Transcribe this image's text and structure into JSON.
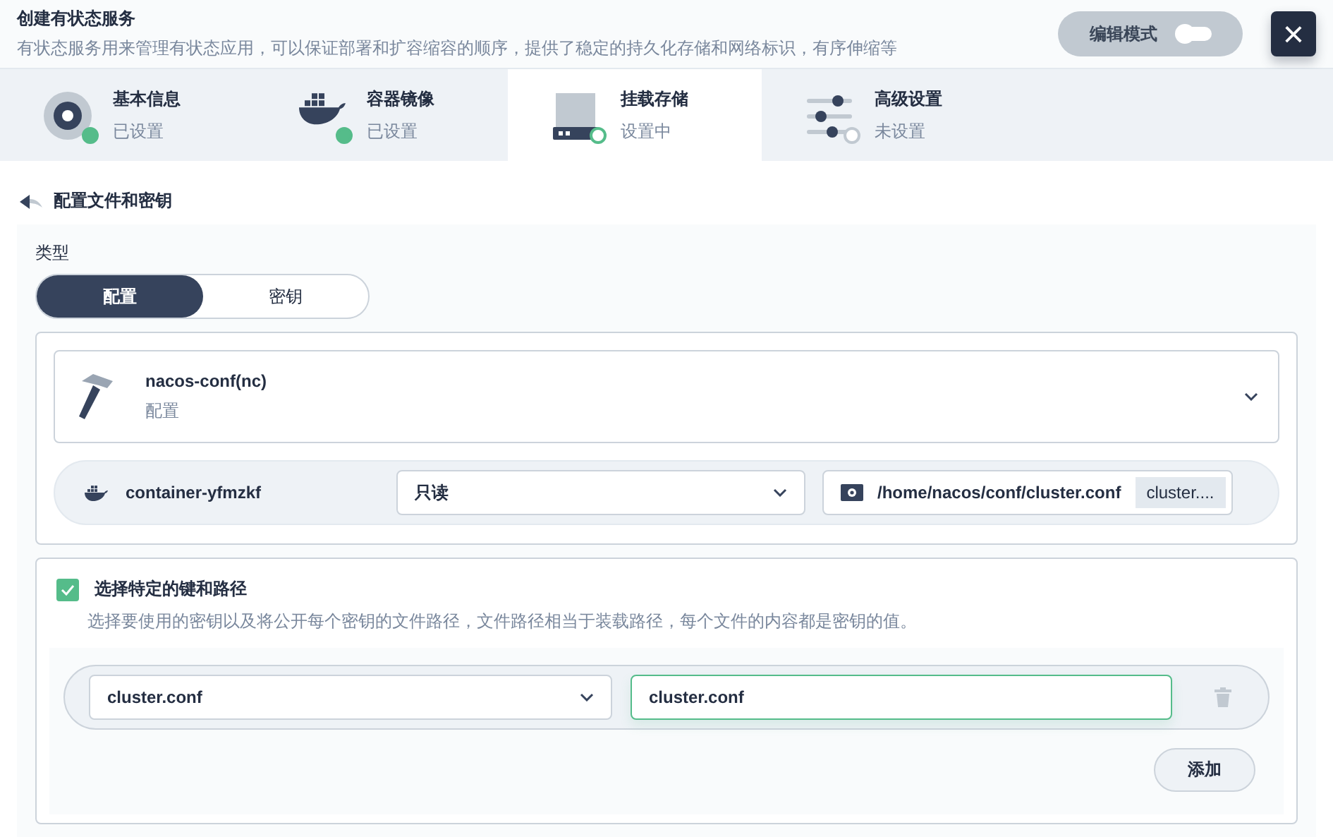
{
  "header": {
    "title": "创建有状态服务",
    "subtitle": "有状态服务用来管理有状态应用，可以保证部署和扩容缩容的顺序，提供了稳定的持久化存储和网络标识，有序伸缩等",
    "edit_mode": {
      "label": "编辑模式",
      "on": false
    },
    "close": "×"
  },
  "steps": [
    {
      "kind": "disc",
      "title": "基本信息",
      "status": "已设置",
      "completed": true,
      "selected": false
    },
    {
      "kind": "docker",
      "title": "容器镜像",
      "status": "已设置",
      "completed": true,
      "selected": false
    },
    {
      "kind": "drive",
      "title": "挂载存储",
      "status": "设置中",
      "completed": false,
      "selected": true
    },
    {
      "kind": "sliders",
      "title": "高级设置",
      "status": "未设置",
      "completed": false,
      "selected": false
    }
  ],
  "section": {
    "title": "配置文件和密钥"
  },
  "type_field": {
    "label": "类型",
    "options": [
      {
        "label": "配置",
        "selected": true
      },
      {
        "label": "密钥",
        "selected": false
      }
    ]
  },
  "resource": {
    "name": "nacos-conf(nc)",
    "type": "配置"
  },
  "mount": {
    "container": "container-yfmzkf",
    "access": "只读",
    "path": "/home/nacos/conf/cluster.conf",
    "sub_path": "cluster...."
  },
  "specific_keys": {
    "checked": true,
    "title": "选择特定的键和路径",
    "description": "选择要使用的密钥以及将公开每个密钥的文件路径，文件路径相当于装载路径，每个文件的内容都是密钥的值。",
    "items": [
      {
        "key": "cluster.conf",
        "path": "cluster.conf"
      }
    ],
    "add_button": "添加"
  }
}
